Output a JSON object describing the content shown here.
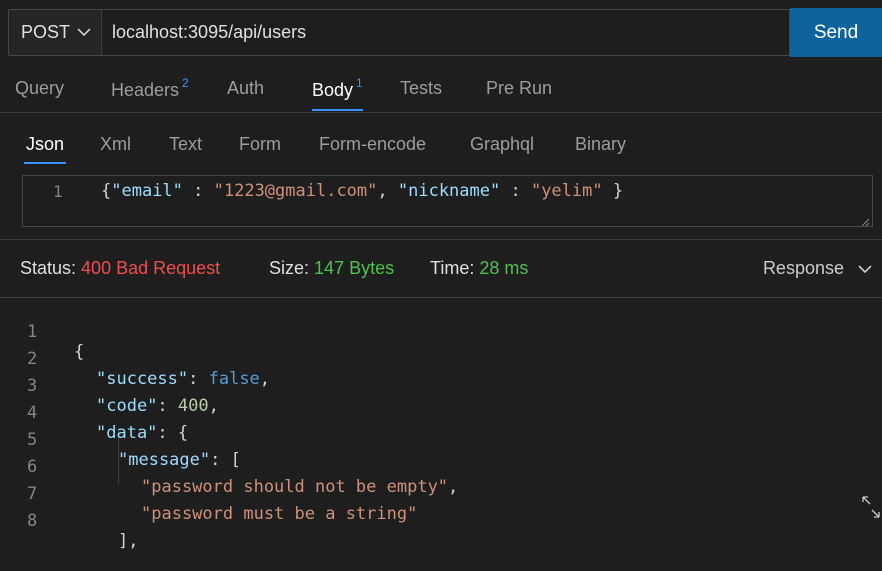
{
  "request": {
    "method": "POST",
    "url": "localhost:3095/api/users",
    "send_label": "Send"
  },
  "tabs": [
    {
      "label": "Query",
      "badge": ""
    },
    {
      "label": "Headers",
      "badge": "2"
    },
    {
      "label": "Auth",
      "badge": ""
    },
    {
      "label": "Body",
      "badge": "1"
    },
    {
      "label": "Tests",
      "badge": ""
    },
    {
      "label": "Pre Run",
      "badge": ""
    }
  ],
  "active_tab": "Body",
  "body_tabs": [
    "Json",
    "Xml",
    "Text",
    "Form",
    "Form-encode",
    "Graphql",
    "Binary"
  ],
  "active_body_tab": "Json",
  "editor": {
    "line_number": "1",
    "open": "{",
    "k1": "\"email\"",
    "sep1": " : ",
    "v1": "\"1223@gmail.com\"",
    "comma": ", ",
    "k2": "\"nickname\"",
    "sep2": " : ",
    "v2": "\"yelim\"",
    "close": " }"
  },
  "status": {
    "status_label": "Status:",
    "status_value": "400 Bad Request",
    "size_label": "Size:",
    "size_value": "147 Bytes",
    "time_label": "Time:",
    "time_value": "28 ms",
    "response_select": "Response"
  },
  "response_lines": [
    {
      "n": "1",
      "t": "{"
    },
    {
      "n": "2",
      "k": "\"success\"",
      "v": "false",
      "vt": "kw",
      "e": ","
    },
    {
      "n": "3",
      "k": "\"code\"",
      "v": "400",
      "vt": "num",
      "e": ","
    },
    {
      "n": "4",
      "k": "\"data\"",
      "v": "{",
      "vt": "punc",
      "e": ""
    },
    {
      "n": "5",
      "k": "\"message\"",
      "v": "[",
      "vt": "punc",
      "e": ""
    },
    {
      "n": "6",
      "s": "\"password should not be empty\"",
      "e": ","
    },
    {
      "n": "7",
      "s": "\"password must be a string\"",
      "e": ""
    },
    {
      "n": "8",
      "t": "],"
    }
  ],
  "colors": {
    "accent": "#0e639c",
    "tab_underline": "#3794ff",
    "status_error": "#f14c4c",
    "status_ok": "#4fc14f"
  }
}
